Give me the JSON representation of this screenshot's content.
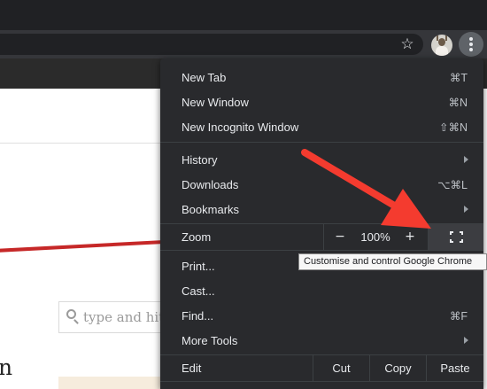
{
  "browser": {
    "toolbar_icons": [
      "star-icon",
      "profile-avatar",
      "more-vert-icon"
    ],
    "star_glyph": "☆"
  },
  "page": {
    "search_placeholder": "type and hit e",
    "partial_letter": "n"
  },
  "menu": {
    "items": [
      {
        "label": "New Tab",
        "shortcut": "⌘T"
      },
      {
        "label": "New Window",
        "shortcut": "⌘N"
      },
      {
        "label": "New Incognito Window",
        "shortcut": "⇧⌘N"
      },
      {
        "label": "History",
        "submenu": true
      },
      {
        "label": "Downloads",
        "shortcut": "⌥⌘L"
      },
      {
        "label": "Bookmarks",
        "submenu": true
      },
      {
        "label": "Print...",
        "shortcut": ""
      },
      {
        "label": "Cast...",
        "shortcut": ""
      },
      {
        "label": "Find...",
        "shortcut": "⌘F"
      },
      {
        "label": "More Tools",
        "submenu": true
      }
    ],
    "zoom": {
      "label": "Zoom",
      "minus": "−",
      "value": "100%",
      "plus": "+"
    },
    "edit": {
      "label": "Edit",
      "cut": "Cut",
      "copy": "Copy",
      "paste": "Paste"
    }
  },
  "tooltip": "Customise and control Google Chrome",
  "colors": {
    "menu_bg": "#292a2d",
    "annotation_arrow": "#f43b2f",
    "page_accent_line": "#c62828"
  }
}
